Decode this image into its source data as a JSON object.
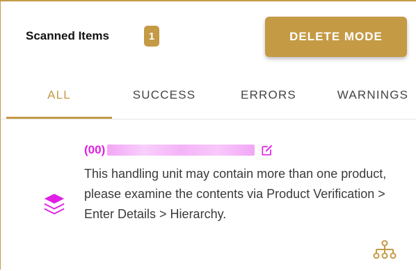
{
  "header": {
    "title": "Scanned Items",
    "count": "1",
    "delete_mode_label": "DELETE MODE"
  },
  "tabs": [
    {
      "label": "ALL",
      "active": true
    },
    {
      "label": "SUCCESS",
      "active": false
    },
    {
      "label": "ERRORS",
      "active": false
    },
    {
      "label": "WARNINGS",
      "active": false
    }
  ],
  "item": {
    "code_prefix": "(00)",
    "code_value_redacted": true,
    "message": "This handling unit may contain more than one product, please examine the contents via Product Verification > Enter Details > Hierarchy.",
    "icons": {
      "status": "layers-icon",
      "edit": "edit-icon",
      "hierarchy": "hierarchy-icon"
    }
  },
  "colors": {
    "accent": "#c49a45",
    "magenta": "#e11fe5",
    "text": "#3a3a3a"
  }
}
